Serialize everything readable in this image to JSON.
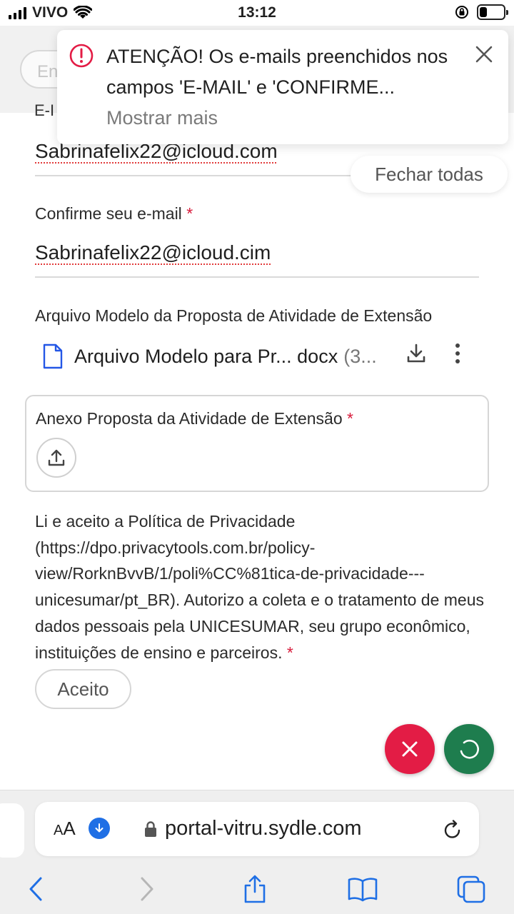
{
  "status_bar": {
    "carrier": "VIVO",
    "time": "13:12"
  },
  "background": {
    "ghost_pill_text": "En",
    "ghost_label": "E-I"
  },
  "form": {
    "email_value": "Sabrinafelix22@icloud.com",
    "confirm_label": "Confirme seu e-mail",
    "confirm_required": "*",
    "confirm_value": "Sabrinafelix22@icloud.cim",
    "template_label": "Arquivo Modelo da Proposta de Atividade de Extensão",
    "template_file_name": "Arquivo Modelo para Pr... docx",
    "template_file_size": "(3...",
    "upload_label": "Anexo Proposta da Atividade de Extensão",
    "upload_required": "*",
    "privacy_text": "Li e aceito a Política de Privacidade (https://dpo.privacytools.com.br/policy-view/RorknBvvB/1/poli%CC%81tica-de-privacidade---unicesumar/pt_BR). Autorizo a coleta e o tratamento de meus dados pessoais pela UNICESUMAR, seu grupo econômico, instituições de ensino e parceiros.",
    "privacy_required": "*",
    "accept_label": "Aceito"
  },
  "notification": {
    "message": "ATENÇÃO! Os e-mails preenchidos nos campos 'E-MAIL' e 'CONFIRME...",
    "show_more": "Mostrar mais",
    "close_all": "Fechar todas"
  },
  "browser": {
    "text_size_label_big": "A",
    "text_size_label_small": "A",
    "url": "portal-vitru.sydle.com"
  },
  "colors": {
    "error_red": "#e31c45",
    "save_green": "#1e7d4e",
    "link_blue": "#1f6fe5"
  },
  "icons": [
    "signal-icon",
    "wifi-icon",
    "orientation-lock-icon",
    "battery-icon",
    "alert-icon",
    "close-icon",
    "document-icon",
    "download-icon",
    "more-vert-icon",
    "upload-icon",
    "cancel-icon",
    "loading-icon",
    "lock-icon",
    "reload-icon",
    "back-icon",
    "forward-icon",
    "share-icon",
    "bookmarks-icon",
    "tabs-icon"
  ]
}
